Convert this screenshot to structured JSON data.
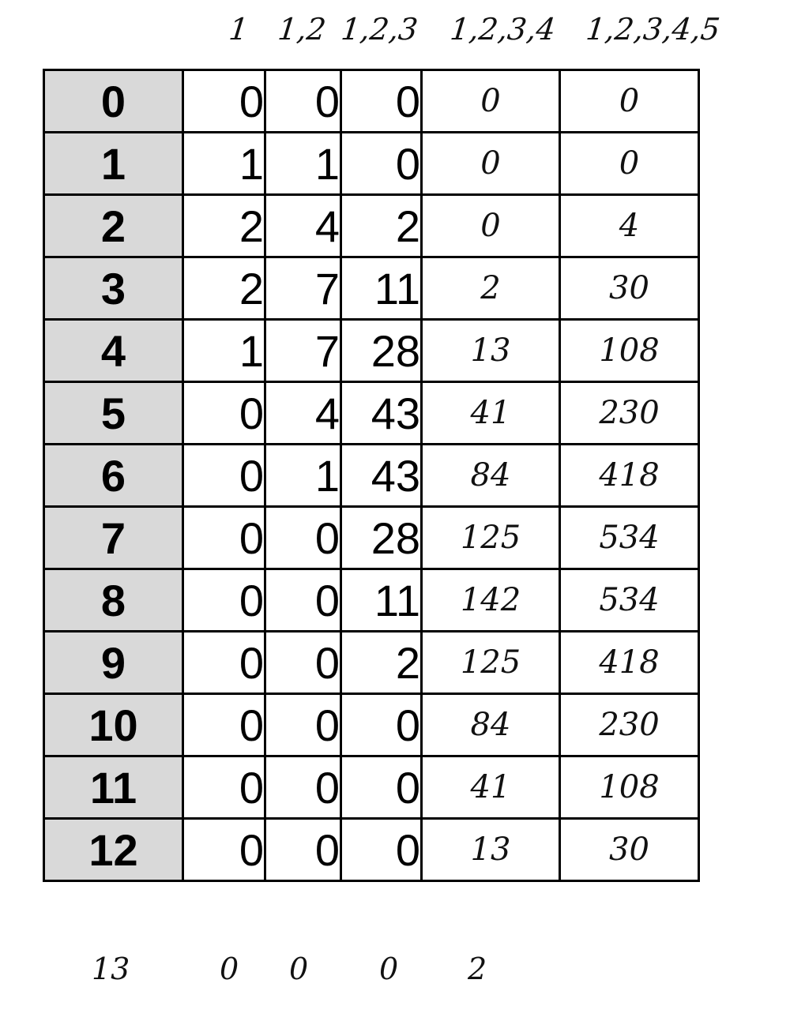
{
  "column_headers": [
    "1",
    "1,2",
    "1,2,3",
    "1,2,3,4",
    "1,2,3,4,5"
  ],
  "rows": [
    {
      "index": "0",
      "c1": "0",
      "c2": "0",
      "c3": "0",
      "c4": "0",
      "c5": "0"
    },
    {
      "index": "1",
      "c1": "1",
      "c2": "1",
      "c3": "0",
      "c4": "0",
      "c5": "0"
    },
    {
      "index": "2",
      "c1": "2",
      "c2": "4",
      "c3": "2",
      "c4": "0",
      "c5": "4"
    },
    {
      "index": "3",
      "c1": "2",
      "c2": "7",
      "c3": "11",
      "c4": "2",
      "c5": "30"
    },
    {
      "index": "4",
      "c1": "1",
      "c2": "7",
      "c3": "28",
      "c4": "13",
      "c5": "108"
    },
    {
      "index": "5",
      "c1": "0",
      "c2": "4",
      "c3": "43",
      "c4": "41",
      "c5": "230"
    },
    {
      "index": "6",
      "c1": "0",
      "c2": "1",
      "c3": "43",
      "c4": "84",
      "c5": "418"
    },
    {
      "index": "7",
      "c1": "0",
      "c2": "0",
      "c3": "28",
      "c4": "125",
      "c5": "534"
    },
    {
      "index": "8",
      "c1": "0",
      "c2": "0",
      "c3": "11",
      "c4": "142",
      "c5": "534"
    },
    {
      "index": "9",
      "c1": "0",
      "c2": "0",
      "c3": "2",
      "c4": "125",
      "c5": "418"
    },
    {
      "index": "10",
      "c1": "0",
      "c2": "0",
      "c3": "0",
      "c4": "84",
      "c5": "230"
    },
    {
      "index": "11",
      "c1": "0",
      "c2": "0",
      "c3": "0",
      "c4": "41",
      "c5": "108"
    },
    {
      "index": "12",
      "c1": "0",
      "c2": "0",
      "c3": "0",
      "c4": "13",
      "c5": "30"
    }
  ],
  "footer_row": {
    "index": "13",
    "c1": "0",
    "c2": "0",
    "c3": "0",
    "c4": "2"
  }
}
